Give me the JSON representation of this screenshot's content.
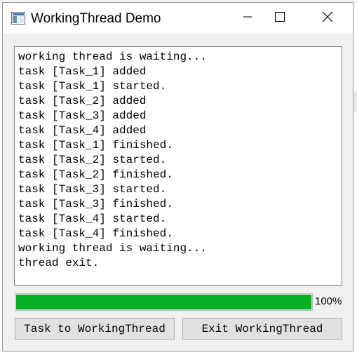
{
  "window": {
    "title": "WorkingThread Demo"
  },
  "titlebar_buttons": {
    "minimize_icon": "minimize-icon",
    "maximize_icon": "maximize-icon",
    "close_icon": "close-icon"
  },
  "log": {
    "lines": [
      "working thread is waiting...",
      "task [Task_1] added",
      "task [Task_1] started.",
      "task [Task_2] added",
      "task [Task_3] added",
      "task [Task_4] added",
      "task [Task_1] finished.",
      "task [Task_2] started.",
      "task [Task_2] finished.",
      "task [Task_3] started.",
      "task [Task_3] finished.",
      "task [Task_4] started.",
      "task [Task_4] finished.",
      "working thread is waiting...",
      "thread exit."
    ]
  },
  "progress": {
    "value": 100,
    "label": "100%",
    "fill_color": "#06b025"
  },
  "buttons": {
    "task_label": "Task to WorkingThread",
    "exit_label": "Exit WorkingThread"
  }
}
